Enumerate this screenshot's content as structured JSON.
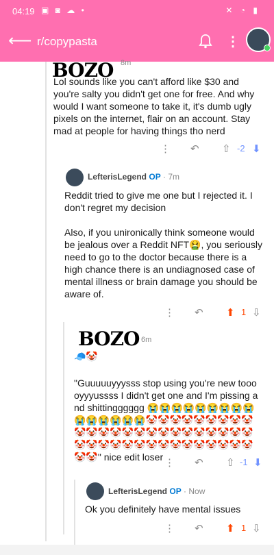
{
  "status": {
    "time": "04:19",
    "indicators": "▣ ◙ ☁ •",
    "system": "✕ ◔ ▮"
  },
  "appbar": {
    "back_glyph": "⟵",
    "title": "r/copypasta",
    "bell_glyph": "🔔",
    "kebab_glyph": "⋮"
  },
  "comments": [
    {
      "author_overlay": "BOZO",
      "time": "8m",
      "text": "Lol sounds like you can't afford like $30 and you're salty you didn't get one for free. And why would I want someone to take it, it's dumb ugly pixels on the internet, flair on an account. Stay mad at people for having things tho nerd",
      "actions": {
        "more": "⋮",
        "reply": "↶",
        "upvote": "⇧",
        "score": "-2",
        "downvote": "⬇"
      }
    },
    {
      "author": "LefterisLegend",
      "op_badge": "OP",
      "time": "· 7m",
      "text": "Reddit tried to give me one but I rejected it. I don't regret my decision\n\nAlso, if you unironically think someone would be jealous over a Reddit NFT🤮, you seriously need to go to the doctor because there is a high chance there is an undiagnosed case of mental illness or brain damage you should be aware of.",
      "actions": {
        "more": "⋮",
        "reply": "↶",
        "upvote": "⬆",
        "score": "1",
        "downvote": "⇩"
      }
    },
    {
      "author_overlay": "BOZO",
      "time": "6m",
      "flair": "🧢🤡",
      "text": "\"Guuuuuyyysss stop using you're new tooooyyyussss I didn't get one and I'm pissing and shittingggggg 😭😭😭😭😭😭😭😭😭😭😭😭😭😭😭🤡🤡🤡🤡🤡🤡🤡🤡🤡🤡🤡🤡🤡🤡🤡🤡🤡🤡🤡🤡🤡🤡🤡🤡🤡🤡🤡🤡🤡🤡🤡🤡🤡🤡🤡🤡🤡🤡🤡🤡🤡\" nice edit loser",
      "actions": {
        "more": "⋮",
        "reply": "↶",
        "upvote": "⇧",
        "score": "-1",
        "downvote": "⬇"
      }
    },
    {
      "author": "LefterisLegend",
      "op_badge": "OP",
      "time": "· Now",
      "text": "Ok you definitely have mental issues",
      "actions": {
        "more": "⋮",
        "reply": "↶",
        "upvote": "⬆",
        "score": "1",
        "downvote": "⇩"
      }
    }
  ],
  "colors": {
    "brand": "#ff6fb0",
    "upvote": "#ff4500",
    "downvote": "#7193ff",
    "op": "#0079d3"
  }
}
